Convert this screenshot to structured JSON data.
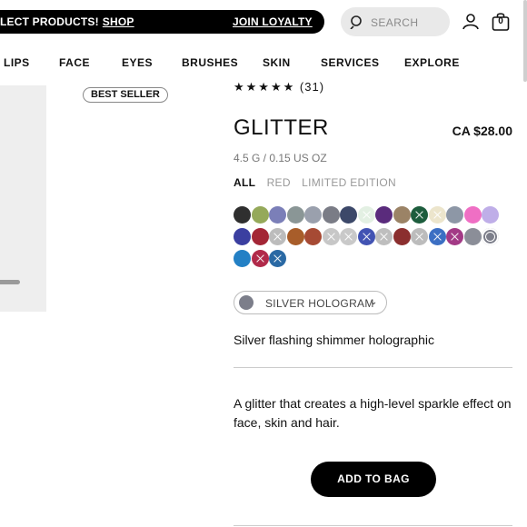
{
  "promo": {
    "message": "LECT PRODUCTS!",
    "shop_link": "SHOP",
    "loyalty_link": "JOIN LOYALTY"
  },
  "search": {
    "placeholder": "SEARCH"
  },
  "bag": {
    "count": "0"
  },
  "nav": [
    "LIPS",
    "FACE",
    "EYES",
    "BRUSHES",
    "SKIN",
    "SERVICES",
    "EXPLORE"
  ],
  "product": {
    "badge": "BEST SELLER",
    "stars": "★★★★★",
    "review_count": "(31)",
    "title": "GLITTER",
    "price": "CA $28.00",
    "size": "4.5 G / 0.15 US OZ",
    "filters": [
      "ALL",
      "RED",
      "LIMITED EDITION"
    ],
    "active_filter": "ALL",
    "selected_shade": "SILVER HOLOGRAM",
    "selected_shade_color": "#7c7e8a",
    "shade_description": "Silver flashing shimmer holographic",
    "description": "A glitter that creates a high-level sparkle effect on face, skin and hair.",
    "add_to_bag": "ADD TO BAG"
  },
  "swatches": [
    [
      {
        "color": "#2f2f2f"
      },
      {
        "color": "#95a95a"
      },
      {
        "color": "#7b7fb8"
      },
      {
        "color": "#8a9696"
      },
      {
        "color": "#9aa0ad"
      },
      {
        "color": "#7a7c86"
      },
      {
        "color": "#3c4869"
      },
      {
        "color": "#e3f0e3",
        "sold_out": true
      },
      {
        "color": "#5a2b7c"
      },
      {
        "color": "#9b8366"
      },
      {
        "color": "#1d5d3d",
        "sold_out": true
      },
      {
        "color": "#ece5cc",
        "sold_out": true
      },
      {
        "color": "#8d97a6"
      },
      {
        "color": "#ef6fc4"
      },
      {
        "color": "#bfaee8"
      }
    ],
    [
      {
        "color": "#3b3fa0"
      },
      {
        "color": "#a32636"
      },
      {
        "color": "#bcbcbc",
        "sold_out": true
      },
      {
        "color": "#a85d2a"
      },
      {
        "color": "#a64a34"
      },
      {
        "color": "#c7c7c7",
        "sold_out": true
      },
      {
        "color": "#c9c9c9",
        "sold_out": true
      },
      {
        "color": "#4253b3",
        "sold_out": true
      },
      {
        "color": "#bebebe",
        "sold_out": true
      },
      {
        "color": "#8b2f2f"
      },
      {
        "color": "#bcbcbc",
        "sold_out": true
      },
      {
        "color": "#3c6fc3",
        "sold_out": true
      },
      {
        "color": "#a33a86",
        "sold_out": true
      },
      {
        "color": "#8b8e98"
      },
      {
        "color": "#7c7e8a",
        "selected": true
      }
    ],
    [
      {
        "color": "#2380c5"
      },
      {
        "color": "#b12a4a",
        "sold_out": true
      },
      {
        "color": "#2a69a4",
        "sold_out": true
      }
    ]
  ]
}
